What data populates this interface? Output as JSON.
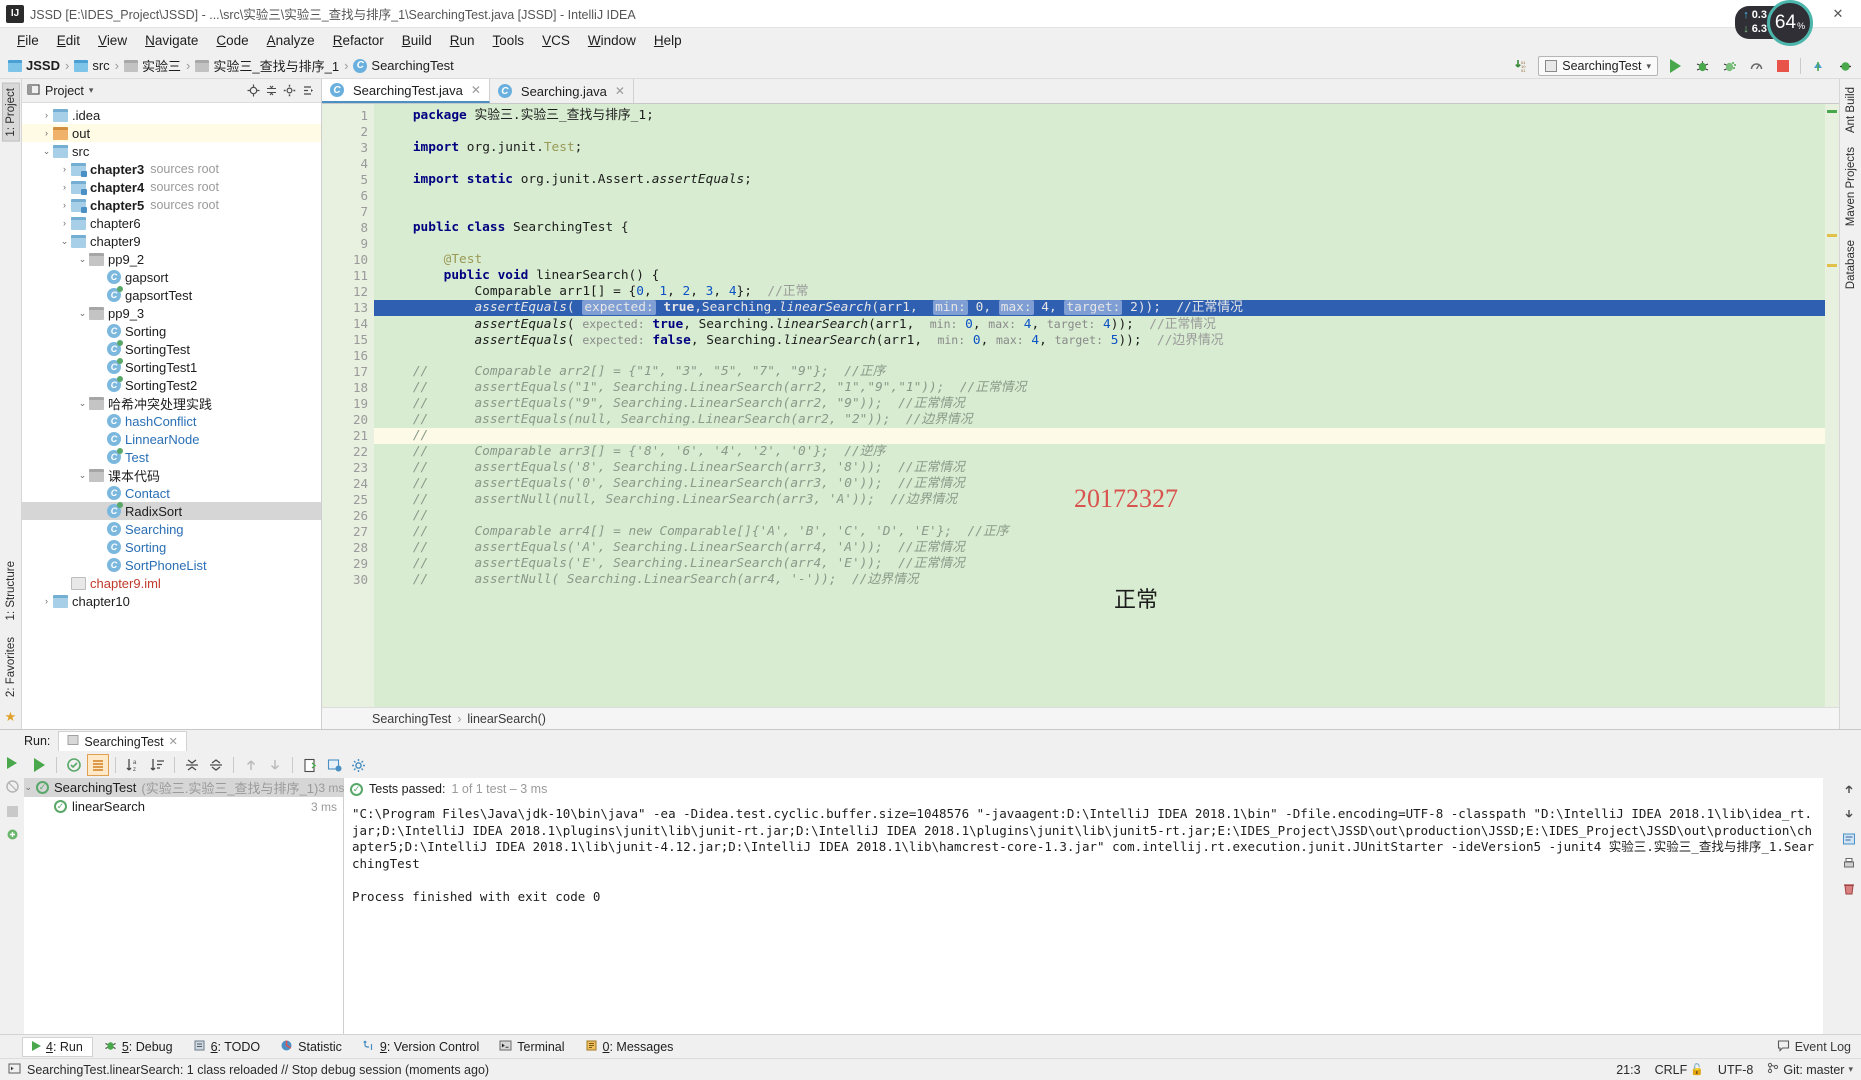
{
  "window": {
    "title": "JSSD [E:\\IDES_Project\\JSSD] - ...\\src\\实验三\\实验三_查找与排序_1\\SearchingTest.java [JSSD] - IntelliJ IDEA",
    "app_icon": "IJ",
    "minimize": "—",
    "maximize": "❐",
    "close": "✕"
  },
  "menu": [
    "File",
    "Edit",
    "View",
    "Navigate",
    "Code",
    "Analyze",
    "Refactor",
    "Build",
    "Run",
    "Tools",
    "VCS",
    "Window",
    "Help"
  ],
  "breadcrumb": [
    {
      "label": "JSSD",
      "icon": "module-icon",
      "bold": true
    },
    {
      "label": "src",
      "icon": "folder-blue-icon",
      "bold": false
    },
    {
      "label": "实验三",
      "icon": "folder-gray-icon",
      "bold": false
    },
    {
      "label": "实验三_查找与排序_1",
      "icon": "folder-gray-icon",
      "bold": false
    },
    {
      "label": "SearchingTest",
      "icon": "java-class-icon",
      "bold": false
    }
  ],
  "toolbar": {
    "run_config": "SearchingTest",
    "download_icon": "update-project-icon",
    "run_icon": "run-icon",
    "debug_icon": "debug-icon",
    "coverage_icon": "run-with-coverage-icon",
    "profile_icon": "profile-icon",
    "stop_icon": "stop-icon",
    "vcs_update_icon": "vcs-update-icon",
    "vcs_commit_icon": "vcs-commit-icon"
  },
  "network_widget": {
    "upload": "0.3",
    "upload_unit": "K/s",
    "download": "6.3",
    "download_unit": "K/s",
    "cpu_value": "64",
    "cpu_unit": "%"
  },
  "left_strip": {
    "project_tab": "1: Project",
    "structure_tab": "1: Structure",
    "favorites_tab": "2: Favorites"
  },
  "right_strip": {
    "ant_build": "Ant Build",
    "maven": "Maven Projects",
    "database": "Database"
  },
  "project_panel": {
    "title": "Project",
    "caret": "▾",
    "collapse_icon": "collapse-all-icon",
    "settings_icon": "gear-icon",
    "locate_icon": "locate-icon",
    "hide_icon": "hide-icon",
    "tree": [
      {
        "label": ".idea",
        "depth": 1,
        "arrow": "›",
        "icon": "folder",
        "state": "normal"
      },
      {
        "label": "out",
        "depth": 1,
        "arrow": "›",
        "icon": "folder-out",
        "state": "highlight"
      },
      {
        "label": "src",
        "depth": 1,
        "arrow": "⌄",
        "icon": "folder",
        "state": "normal"
      },
      {
        "label": "chapter3",
        "note": "sources root",
        "depth": 2,
        "arrow": "›",
        "icon": "folder-src",
        "bold": true,
        "state": "normal"
      },
      {
        "label": "chapter4",
        "note": "sources root",
        "depth": 2,
        "arrow": "›",
        "icon": "folder-src",
        "bold": true,
        "state": "normal"
      },
      {
        "label": "chapter5",
        "note": "sources root",
        "depth": 2,
        "arrow": "›",
        "icon": "folder-src",
        "bold": true,
        "state": "normal"
      },
      {
        "label": "chapter6",
        "depth": 2,
        "arrow": "›",
        "icon": "folder",
        "state": "normal"
      },
      {
        "label": "chapter9",
        "depth": 2,
        "arrow": "⌄",
        "icon": "folder",
        "state": "normal"
      },
      {
        "label": "pp9_2",
        "depth": 3,
        "arrow": "⌄",
        "icon": "folder-gray",
        "state": "normal"
      },
      {
        "label": "gapsort",
        "depth": 4,
        "arrow": "",
        "icon": "class",
        "state": "normal"
      },
      {
        "label": "gapsortTest",
        "depth": 4,
        "arrow": "",
        "icon": "class-test",
        "state": "normal"
      },
      {
        "label": "pp9_3",
        "depth": 3,
        "arrow": "⌄",
        "icon": "folder-gray",
        "state": "normal"
      },
      {
        "label": "Sorting",
        "depth": 4,
        "arrow": "",
        "icon": "class",
        "state": "normal"
      },
      {
        "label": "SortingTest",
        "depth": 4,
        "arrow": "",
        "icon": "class-test",
        "state": "normal"
      },
      {
        "label": "SortingTest1",
        "depth": 4,
        "arrow": "",
        "icon": "class-test",
        "state": "normal"
      },
      {
        "label": "SortingTest2",
        "depth": 4,
        "arrow": "",
        "icon": "class-test",
        "state": "normal"
      },
      {
        "label": "哈希冲突处理实践",
        "depth": 3,
        "arrow": "⌄",
        "icon": "folder-gray",
        "state": "normal"
      },
      {
        "label": "hashConflict",
        "depth": 4,
        "arrow": "",
        "icon": "class",
        "state": "blue"
      },
      {
        "label": "LinnearNode",
        "depth": 4,
        "arrow": "",
        "icon": "class",
        "state": "blue"
      },
      {
        "label": "Test",
        "depth": 4,
        "arrow": "",
        "icon": "class-test",
        "state": "blue"
      },
      {
        "label": "课本代码",
        "depth": 3,
        "arrow": "⌄",
        "icon": "folder-gray",
        "state": "normal"
      },
      {
        "label": "Contact",
        "depth": 4,
        "arrow": "",
        "icon": "class",
        "state": "blue"
      },
      {
        "label": "RadixSort",
        "depth": 4,
        "arrow": "",
        "icon": "class-test",
        "state": "selected"
      },
      {
        "label": "Searching",
        "depth": 4,
        "arrow": "",
        "icon": "class",
        "state": "blue"
      },
      {
        "label": "Sorting",
        "depth": 4,
        "arrow": "",
        "icon": "class",
        "state": "blue"
      },
      {
        "label": "SortPhoneList",
        "depth": 4,
        "arrow": "",
        "icon": "class",
        "state": "blue"
      },
      {
        "label": "chapter9.iml",
        "depth": 2,
        "arrow": "",
        "icon": "iml",
        "state": "red"
      },
      {
        "label": "chapter10",
        "depth": 1,
        "arrow": "›",
        "icon": "folder",
        "state": "normal"
      }
    ]
  },
  "editor": {
    "tabs": [
      {
        "label": "SearchingTest.java",
        "icon": "java-class-icon",
        "active": true,
        "close": "✕"
      },
      {
        "label": "Searching.java",
        "icon": "java-class-icon",
        "active": false,
        "close": "✕"
      }
    ],
    "watermark": "20172327",
    "watermark_cn": "正常",
    "breadcrumb_class": "SearchingTest",
    "breadcrumb_sep": "›",
    "breadcrumb_method": "linearSearch()",
    "lines": [
      {
        "n": 1,
        "html": "    <span class=\"kw\">package</span> <span class=\"typ\">实验三.实验三_查找与排序_1;</span>"
      },
      {
        "n": 2,
        "html": ""
      },
      {
        "n": 3,
        "html": "    <span class=\"kw\">import</span> <span class=\"typ\">org.junit.</span><span class=\"ann\">Test</span><span class=\"typ\">;</span>"
      },
      {
        "n": 4,
        "html": ""
      },
      {
        "n": 5,
        "html": "    <span class=\"kw\">import static</span> <span class=\"typ\">org.junit.Assert.</span><span class=\"mth\">assertEquals</span><span class=\"typ\">;</span>"
      },
      {
        "n": 6,
        "html": ""
      },
      {
        "n": 7,
        "html": ""
      },
      {
        "n": 8,
        "html": "    <span class=\"kw\">public class</span> <span class=\"typ\">SearchingTest {</span>",
        "mark": "run-gutter-icon"
      },
      {
        "n": 9,
        "html": ""
      },
      {
        "n": 10,
        "html": "        <span class=\"ann\">@Test</span>"
      },
      {
        "n": 11,
        "html": "        <span class=\"kw\">public void</span> <span class=\"typ\">linearSearch() {</span>",
        "mark": "run-gutter-icon"
      },
      {
        "n": 12,
        "html": "            <span class=\"typ\">Comparable arr1[] = {</span><span class=\"num\">0</span><span class=\"typ\">, </span><span class=\"num\">1</span><span class=\"typ\">, </span><span class=\"num\">2</span><span class=\"typ\">, </span><span class=\"num\">3</span><span class=\"typ\">, </span><span class=\"num\">4</span><span class=\"typ\">};  </span><span class=\"cmt-grey\">//正常</span>"
      },
      {
        "n": 13,
        "sel": true,
        "html": "            <span class=\"mth\">assertEquals</span><span class=\"typ\">( </span><span class=\"hint-chip-s\">expected:</span><span class=\"typ\"> </span><span class=\"kw\">true</span><span class=\"typ\">,Searching.</span><span class=\"mth\">linearSearch</span><span class=\"typ\">(arr1,  </span><span class=\"hint-chip-s\">min:</span><span class=\"typ\"> </span><span class=\"num\">0</span><span class=\"typ\">, </span><span class=\"hint-chip-s\">max:</span><span class=\"typ\"> </span><span class=\"num\">4</span><span class=\"typ\">, </span><span class=\"hint-chip-s\">target:</span><span class=\"typ\"> </span><span class=\"num\">2</span><span class=\"typ\">));  </span><span class=\"cmt-grey\">//正常情况</span>"
      },
      {
        "n": 14,
        "html": "            <span class=\"mth\">assertEquals</span><span class=\"typ\">( </span><span class=\"hint\">expected:</span><span class=\"typ\"> </span><span class=\"kw\">true</span><span class=\"typ\">, Searching.</span><span class=\"mth\">linearSearch</span><span class=\"typ\">(arr1,  </span><span class=\"hint\">min:</span><span class=\"typ\"> </span><span class=\"num\">0</span><span class=\"typ\">, </span><span class=\"hint\">max:</span><span class=\"typ\"> </span><span class=\"num\">4</span><span class=\"typ\">, </span><span class=\"hint\">target:</span><span class=\"typ\"> </span><span class=\"num\">4</span><span class=\"typ\">));  </span><span class=\"cmt-grey\">//正常情况</span>"
      },
      {
        "n": 15,
        "html": "            <span class=\"mth\">assertEquals</span><span class=\"typ\">( </span><span class=\"hint\">expected:</span><span class=\"typ\"> </span><span class=\"kw\">false</span><span class=\"typ\">, Searching.</span><span class=\"mth\">linearSearch</span><span class=\"typ\">(arr1,  </span><span class=\"hint\">min:</span><span class=\"typ\"> </span><span class=\"num\">0</span><span class=\"typ\">, </span><span class=\"hint\">max:</span><span class=\"typ\"> </span><span class=\"num\">4</span><span class=\"typ\">, </span><span class=\"hint\">target:</span><span class=\"typ\"> </span><span class=\"num\">5</span><span class=\"typ\">));  </span><span class=\"cmt-grey\">//边界情况</span>"
      },
      {
        "n": 16,
        "html": ""
      },
      {
        "n": 17,
        "html": "    <span class=\"cmt\">//      Comparable arr2[] = {\"1\", \"3\", \"5\", \"7\", \"9\"};  //正序</span>"
      },
      {
        "n": 18,
        "html": "    <span class=\"cmt\">//      assertEquals(\"1\", Searching.LinearSearch(arr2, \"1\",\"9\",\"1\"));  //正常情况</span>"
      },
      {
        "n": 19,
        "html": "    <span class=\"cmt\">//      assertEquals(\"9\", Searching.LinearSearch(arr2, \"9\"));  //正常情况</span>"
      },
      {
        "n": 20,
        "html": "    <span class=\"cmt\">//      assertEquals(null, Searching.LinearSearch(arr2, \"2\"));  //边界情况</span>",
        "mark": "bulb-icon"
      },
      {
        "n": 21,
        "caret": true,
        "html": "    <span class=\"cmt\">//</span>"
      },
      {
        "n": 22,
        "html": "    <span class=\"cmt\">//      Comparable arr3[] = {'8', '6', '4', '2', '0'};  //逆序</span>"
      },
      {
        "n": 23,
        "html": "    <span class=\"cmt\">//      assertEquals('8', Searching.LinearSearch(arr3, '8'));  //正常情况</span>"
      },
      {
        "n": 24,
        "html": "    <span class=\"cmt\">//      assertEquals('0', Searching.LinearSearch(arr3, '0'));  //正常情况</span>"
      },
      {
        "n": 25,
        "html": "    <span class=\"cmt\">//      assertNull(null, Searching.LinearSearch(arr3, 'A'));  //边界情况</span>"
      },
      {
        "n": 26,
        "html": "    <span class=\"cmt\">//</span>"
      },
      {
        "n": 27,
        "html": "    <span class=\"cmt\">//      Comparable arr4[] = new Comparable[]{'A', 'B', 'C', 'D', 'E'};  //正序</span>"
      },
      {
        "n": 28,
        "html": "    <span class=\"cmt\">//      assertEquals('A', Searching.LinearSearch(arr4, 'A'));  //正常情况</span>"
      },
      {
        "n": 29,
        "html": "    <span class=\"cmt\">//      assertEquals('E', Searching.LinearSearch(arr4, 'E'));  //正常情况</span>"
      },
      {
        "n": 30,
        "html": "    <span class=\"cmt\">//      assertNull( Searching.LinearSearch(arr4, '-'));  //边界情况</span>"
      }
    ]
  },
  "run_panel": {
    "label": "Run:",
    "tab": "SearchingTest",
    "tab_close": "✕",
    "toolbar_icons": [
      "rerun-icon",
      "toggle-passed-icon",
      "show-ignored-icon",
      "sort-alphabetically-icon",
      "sort-duration-icon",
      "expand-all-icon",
      "collapse-all-icon",
      "prev-test-icon",
      "next-test-icon",
      "export-icon",
      "open-in-browser-icon",
      "settings-icon"
    ],
    "status": "Tests passed:",
    "status_detail": "1 of 1 test – 3 ms",
    "tree": [
      {
        "label": "SearchingTest",
        "note": "(实验三.实验三_查找与排序_1)",
        "time": "3 ms",
        "depth": 0,
        "arrow": "⌄",
        "selected": true
      },
      {
        "label": "linearSearch",
        "note": "",
        "time": "3 ms",
        "depth": 1,
        "arrow": "",
        "selected": false
      }
    ],
    "console": "\"C:\\Program Files\\Java\\jdk-10\\bin\\java\" -ea -Didea.test.cyclic.buffer.size=1048576 \"-javaagent:D:\\IntelliJ IDEA 2018.1\\bin\" -Dfile.encoding=UTF-8 -classpath \"D:\\IntelliJ IDEA 2018.1\\lib\\idea_rt.jar;D:\\IntelliJ IDEA 2018.1\\plugins\\junit\\lib\\junit-rt.jar;D:\\IntelliJ IDEA 2018.1\\plugins\\junit\\lib\\junit5-rt.jar;E:\\IDES_Project\\JSSD\\out\\production\\JSSD;E:\\IDES_Project\\JSSD\\out\\production\\chapter5;D:\\IntelliJ IDEA 2018.1\\lib\\junit-4.12.jar;D:\\IntelliJ IDEA 2018.1\\lib\\hamcrest-core-1.3.jar\" com.intellij.rt.execution.junit.JUnitStarter -ideVersion5 -junit4 实验三.实验三_查找与排序_1.SearchingTest\n\nProcess finished with exit code 0"
  },
  "tool_window_bar": [
    {
      "num": "4",
      "label": ": Run",
      "icon": "run-icon",
      "selected": true
    },
    {
      "num": "5",
      "label": ": Debug",
      "icon": "debug-icon",
      "selected": false
    },
    {
      "num": "6",
      "label": ": TODO",
      "icon": "todo-icon",
      "selected": false
    },
    {
      "num": "",
      "label": "Statistic",
      "icon": "statistic-icon",
      "selected": false
    },
    {
      "num": "9",
      "label": ": Version Control",
      "icon": "vcs-icon",
      "selected": false
    },
    {
      "num": "",
      "label": "Terminal",
      "icon": "terminal-icon",
      "selected": false
    },
    {
      "num": "0",
      "label": ": Messages",
      "icon": "messages-icon",
      "selected": false
    }
  ],
  "event_log": {
    "label": "Event Log",
    "icon": "balloon-icon"
  },
  "status_bar": {
    "message": "SearchingTest.linearSearch: 1 class reloaded // Stop debug session (moments ago)",
    "message_icon": "console-icon",
    "caret_position": "21:3",
    "line_separator": "CRLF",
    "encoding": "UTF-8",
    "git_branch": "Git: master",
    "lock_icon": "unlocked-icon"
  }
}
